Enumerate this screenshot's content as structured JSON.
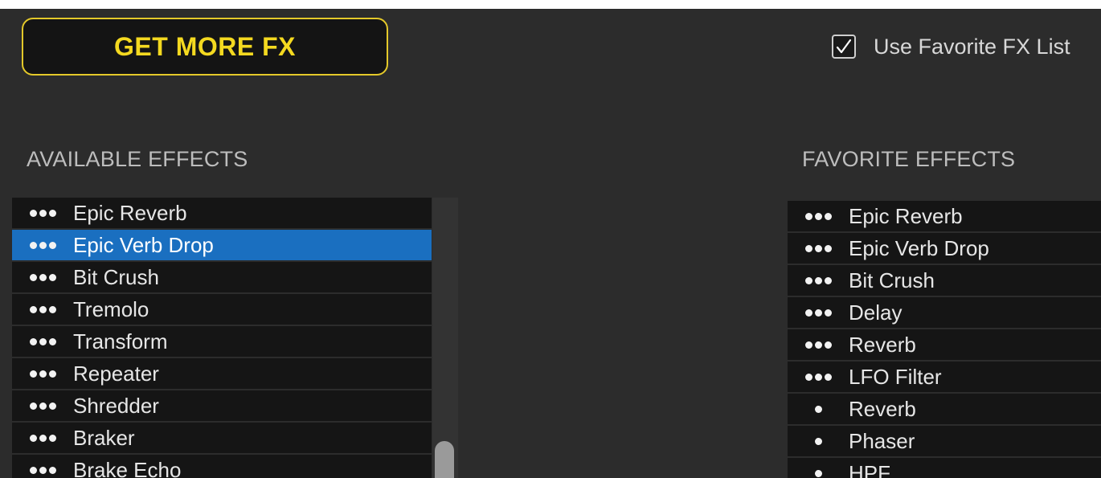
{
  "get_more_fx_label": "GET MORE FX",
  "use_favorite": {
    "label": "Use Favorite FX List",
    "checked": true
  },
  "available": {
    "title": "AVAILABLE EFFECTS",
    "items": [
      {
        "label": "Epic Reverb",
        "dots": 3,
        "selected": false
      },
      {
        "label": "Epic Verb Drop",
        "dots": 3,
        "selected": true
      },
      {
        "label": "Bit Crush",
        "dots": 3,
        "selected": false
      },
      {
        "label": "Tremolo",
        "dots": 3,
        "selected": false
      },
      {
        "label": "Transform",
        "dots": 3,
        "selected": false
      },
      {
        "label": "Repeater",
        "dots": 3,
        "selected": false
      },
      {
        "label": "Shredder",
        "dots": 3,
        "selected": false
      },
      {
        "label": "Braker",
        "dots": 3,
        "selected": false
      },
      {
        "label": "Brake Echo",
        "dots": 3,
        "selected": false
      }
    ]
  },
  "favorites": {
    "title": "FAVORITE EFFECTS",
    "items": [
      {
        "label": "Epic Reverb",
        "dots": 3
      },
      {
        "label": "Epic Verb Drop",
        "dots": 3
      },
      {
        "label": "Bit Crush",
        "dots": 3
      },
      {
        "label": "Delay",
        "dots": 3
      },
      {
        "label": "Reverb",
        "dots": 3
      },
      {
        "label": "LFO Filter",
        "dots": 3
      },
      {
        "label": "Reverb",
        "dots": 1
      },
      {
        "label": "Phaser",
        "dots": 1
      },
      {
        "label": "HPF",
        "dots": 1
      }
    ]
  },
  "colors": {
    "accent_yellow": "#f4d920",
    "selection_blue": "#1a6fc0",
    "panel_bg": "#2c2c2c",
    "row_bg": "#151515"
  }
}
